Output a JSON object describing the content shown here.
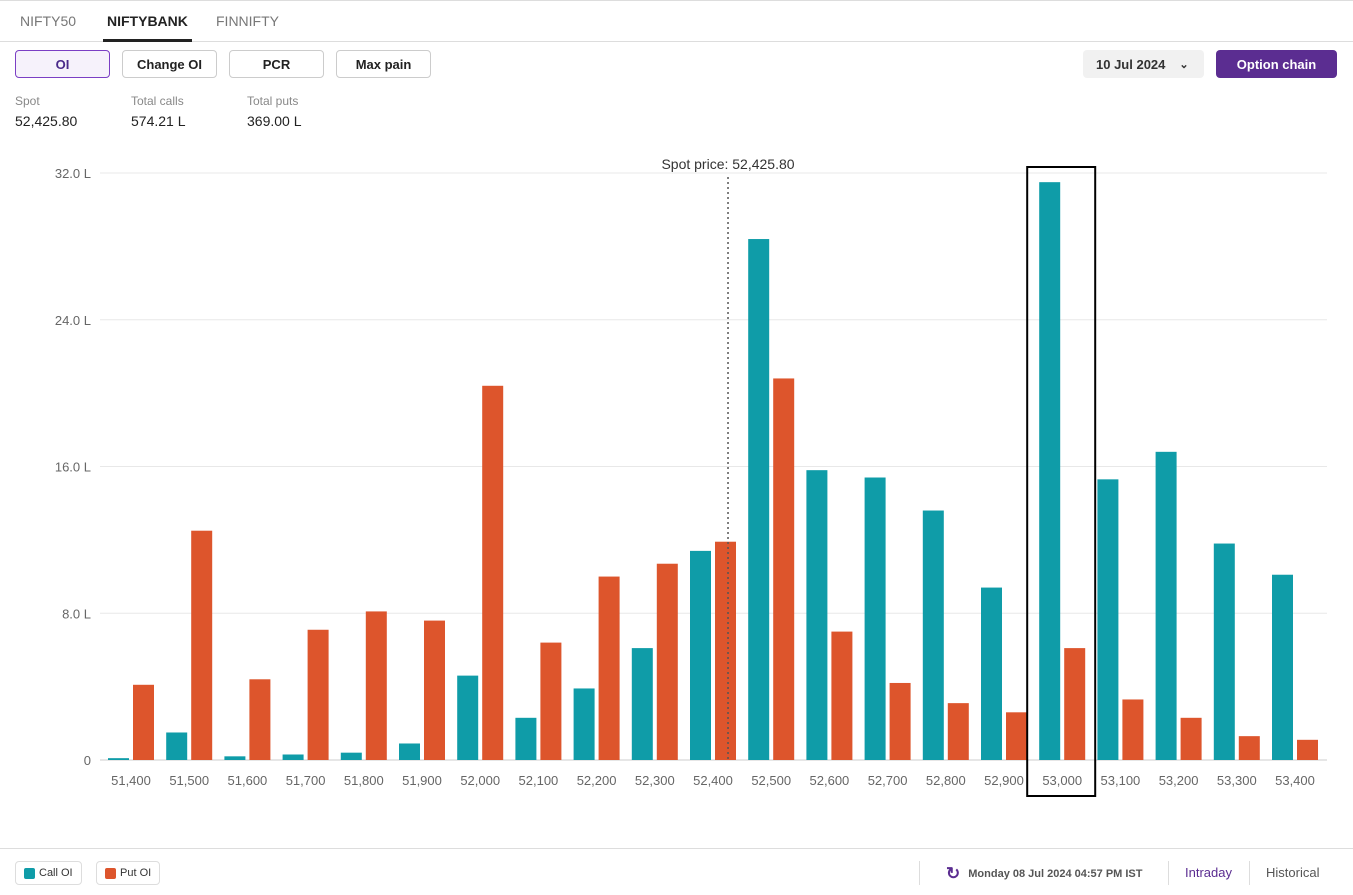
{
  "tabs": [
    "NIFTY50",
    "NIFTYBANK",
    "FINNIFTY"
  ],
  "active_tab": "NIFTYBANK",
  "toolbar": {
    "buttons": [
      "OI",
      "Change OI",
      "PCR",
      "Max pain"
    ],
    "active": "OI",
    "expiry": "10 Jul 2024",
    "option_chain": "Option chain"
  },
  "stats": {
    "spot_label": "Spot",
    "spot": "52,425.80",
    "calls_label": "Total calls",
    "calls": "574.21 L",
    "puts_label": "Total puts",
    "puts": "369.00 L"
  },
  "footer": {
    "legend": [
      "Call OI",
      "Put OI"
    ],
    "timestamp": "Monday 08 Jul 2024 04:57 PM IST",
    "intraday": "Intraday",
    "historical": "Historical"
  },
  "colors": {
    "call": "#0f9ca8",
    "put": "#dd552c",
    "accent": "#5b2d91"
  },
  "chart_data": {
    "type": "bar",
    "categories": [
      "51,400",
      "51,500",
      "51,600",
      "51,700",
      "51,800",
      "51,900",
      "52,000",
      "52,100",
      "52,200",
      "52,300",
      "52,400",
      "52,500",
      "52,600",
      "52,700",
      "52,800",
      "52,900",
      "53,000",
      "53,100",
      "53,200",
      "53,300",
      "53,400"
    ],
    "series": [
      {
        "name": "Call OI",
        "values": [
          0.1,
          1.5,
          0.2,
          0.3,
          0.4,
          0.9,
          4.6,
          2.3,
          3.9,
          6.1,
          11.4,
          28.4,
          15.8,
          15.4,
          13.6,
          9.4,
          31.5,
          15.3,
          16.8,
          11.8,
          10.1
        ]
      },
      {
        "name": "Put OI",
        "values": [
          4.1,
          12.5,
          4.4,
          7.1,
          8.1,
          7.6,
          20.4,
          6.4,
          10.0,
          10.7,
          11.9,
          20.8,
          7.0,
          4.2,
          3.1,
          2.6,
          6.1,
          3.3,
          2.3,
          1.3,
          1.1
        ]
      }
    ],
    "unit": "L",
    "yticks": [
      "0",
      "8.0 L",
      "16.0 L",
      "24.0 L",
      "32.0 L"
    ],
    "ylim": [
      0,
      32
    ],
    "grid": true,
    "legend": "bottom-left",
    "spot": {
      "value": 52425.8,
      "label": "Spot price: 52,425.80"
    },
    "highlight": "53,000"
  }
}
